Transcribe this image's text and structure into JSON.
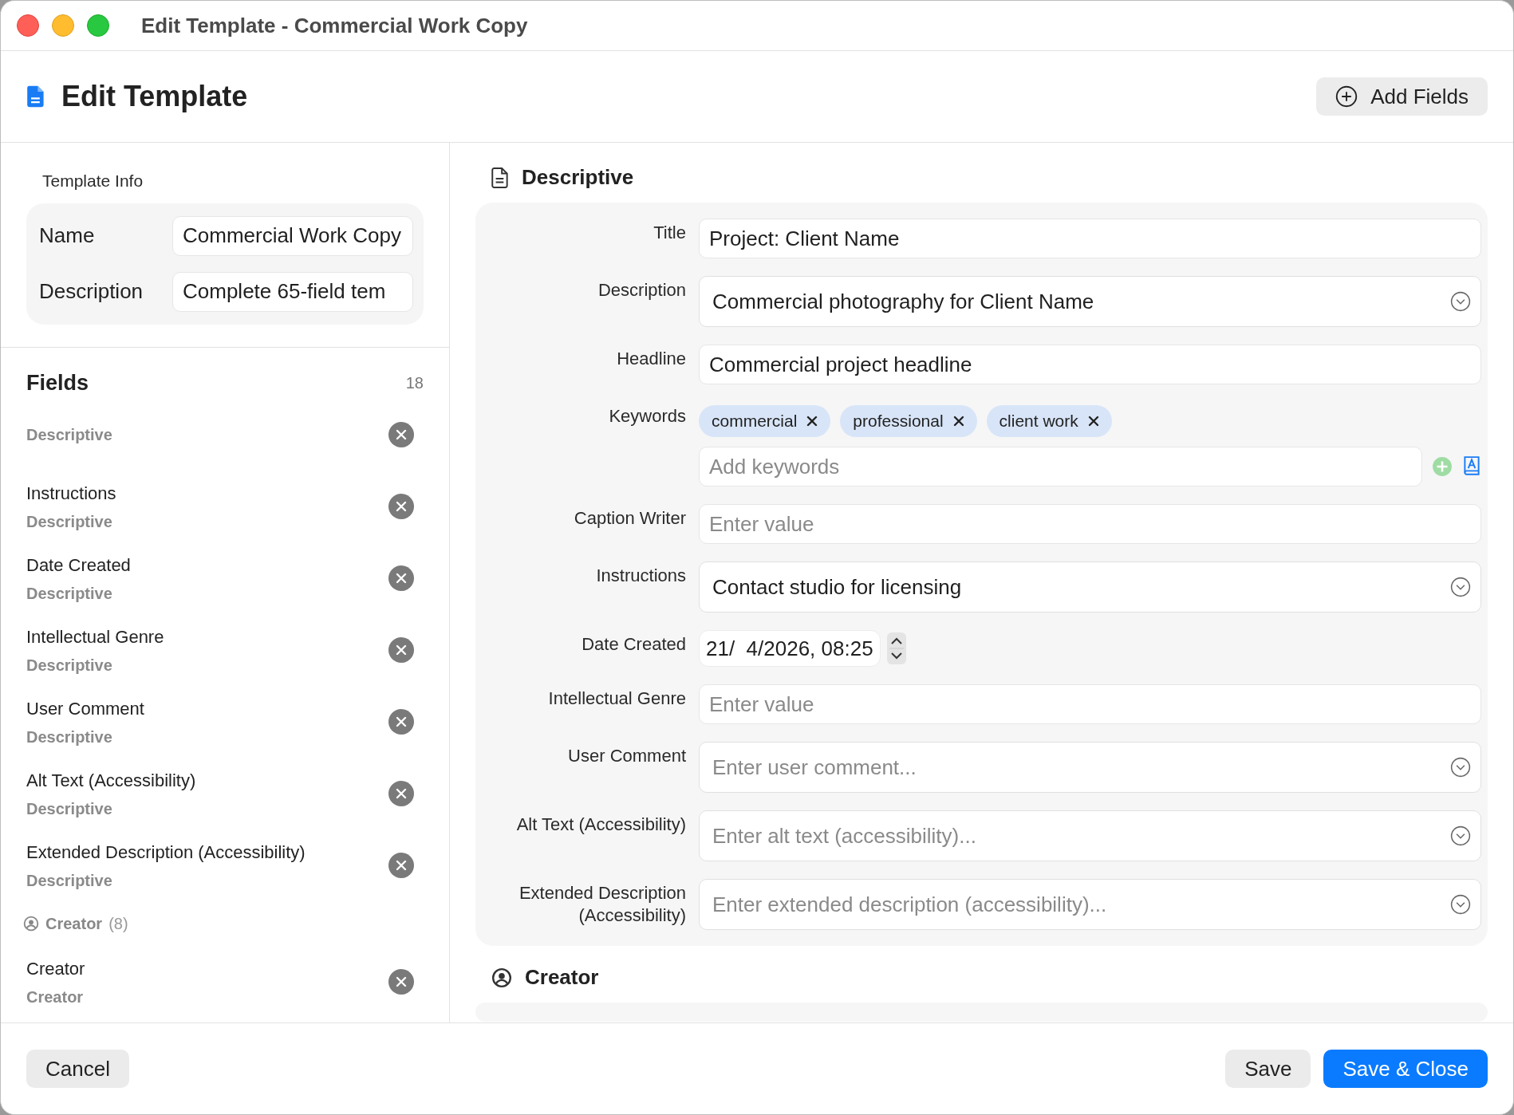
{
  "window": {
    "title": "Edit Template - Commercial Work Copy"
  },
  "header": {
    "title": "Edit Template",
    "add_button": "Add Fields"
  },
  "template_info": {
    "heading": "Template Info",
    "rows": [
      {
        "label": "Name",
        "value": "Commercial Work Copy"
      },
      {
        "label": "Description",
        "value": "Complete 65-field tem"
      }
    ]
  },
  "fields": {
    "heading": "Fields",
    "count": "18",
    "items": [
      {
        "kind": "field",
        "category": "Descriptive"
      },
      {
        "kind": "field",
        "name": "Instructions",
        "category": "Descriptive"
      },
      {
        "kind": "field",
        "name": "Date Created",
        "category": "Descriptive"
      },
      {
        "kind": "field",
        "name": "Intellectual Genre",
        "category": "Descriptive"
      },
      {
        "kind": "field",
        "name": "User Comment",
        "category": "Descriptive"
      },
      {
        "kind": "field",
        "name": "Alt Text (Accessibility)",
        "category": "Descriptive"
      },
      {
        "kind": "field",
        "name": "Extended Description (Accessibility)",
        "category": "Descriptive"
      },
      {
        "kind": "group",
        "name": "Creator",
        "count": "(8)"
      },
      {
        "kind": "field",
        "name": "Creator",
        "category": "Creator"
      }
    ]
  },
  "sections": [
    {
      "title": "Descriptive",
      "rows": [
        {
          "kind": "text",
          "label": "Title",
          "value": "Project: Client Name"
        },
        {
          "kind": "multiline",
          "label": "Description",
          "value": "Commercial photography for Client Name"
        },
        {
          "kind": "text",
          "label": "Headline",
          "value": "Commercial project headline"
        },
        {
          "kind": "keywords",
          "label": "Keywords",
          "keywords": [
            "commercial",
            "professional",
            "client work"
          ],
          "placeholder": "Add keywords"
        },
        {
          "kind": "text",
          "label": "Caption Writer",
          "placeholder": "Enter value"
        },
        {
          "kind": "multiline",
          "label": "Instructions",
          "value": "Contact studio for licensing"
        },
        {
          "kind": "date",
          "label": "Date Created",
          "value": "21/  4/2026, 08:25"
        },
        {
          "kind": "text",
          "label": "Intellectual Genre",
          "placeholder": "Enter value"
        },
        {
          "kind": "multiline",
          "label": "User Comment",
          "placeholder": "Enter user comment..."
        },
        {
          "kind": "multiline",
          "label": "Alt Text (Accessibility)",
          "placeholder": "Enter alt text (accessibility)..."
        },
        {
          "kind": "multiline",
          "label": "Extended Description (Accessibility)",
          "placeholder": "Enter extended description (accessibility)..."
        }
      ]
    },
    {
      "title": "Creator"
    }
  ],
  "footer": {
    "cancel": "Cancel",
    "save": "Save",
    "save_close": "Save & Close"
  }
}
